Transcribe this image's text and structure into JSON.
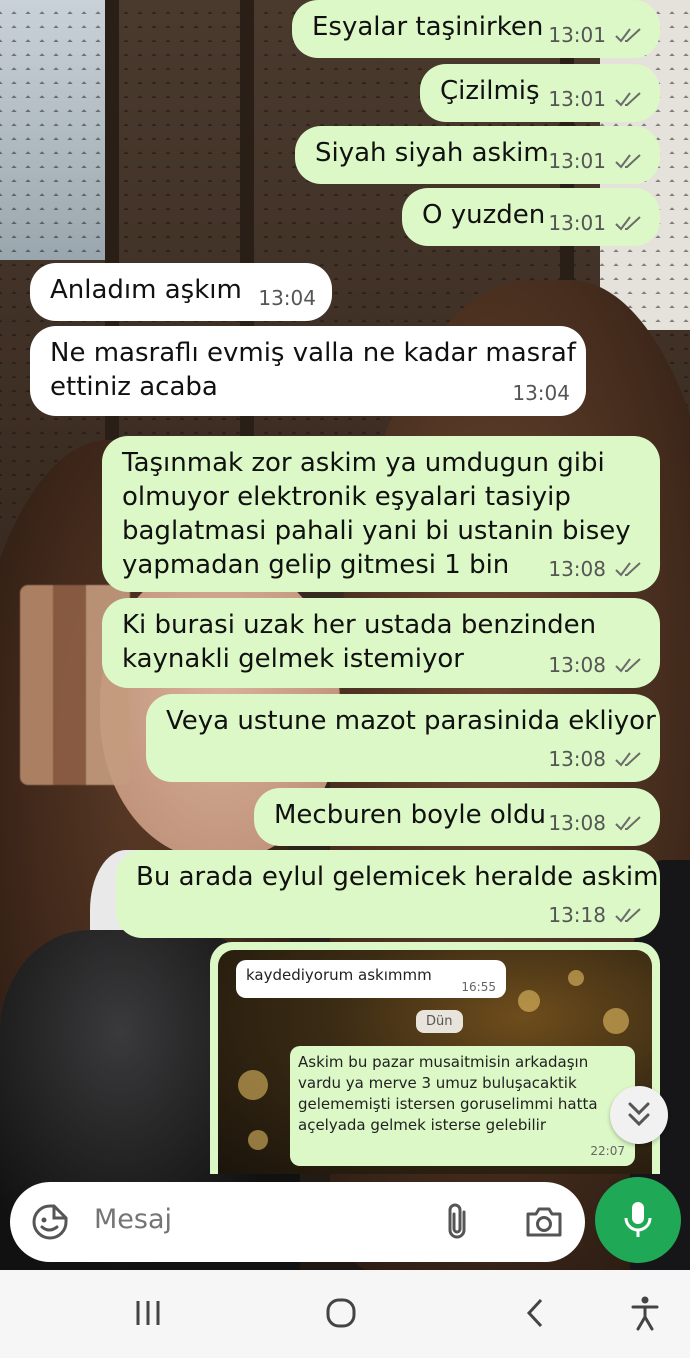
{
  "messages": [
    {
      "dir": "out",
      "text": "Esyalar taşinirken",
      "time": "13:01"
    },
    {
      "dir": "out",
      "text": "Çizilmiş",
      "time": "13:01"
    },
    {
      "dir": "out",
      "text": "Siyah siyah askim",
      "time": "13:01"
    },
    {
      "dir": "out",
      "text": "O yuzden",
      "time": "13:01"
    },
    {
      "dir": "in",
      "text": "Anladım aşkım",
      "time": "13:04"
    },
    {
      "dir": "in",
      "text": "Ne masraflı evmiş valla ne kadar masraf\nettiniz acaba",
      "time": "13:04"
    },
    {
      "dir": "out",
      "text": "Taşınmak zor askim ya umdugun gibi\nolmuyor elektronik eşyalari tasiyip\nbaglatmasi pahali yani bi ustanin bisey\nyapmadan gelip gitmesi 1 bin",
      "time": "13:08"
    },
    {
      "dir": "out",
      "text": "Ki burasi uzak her ustada benzinden\nkaynakli gelmek istemiyor",
      "time": "13:08"
    },
    {
      "dir": "out",
      "text": "Veya ustune mazot parasinida ekliyor",
      "time": "13:08"
    },
    {
      "dir": "out",
      "text": "Mecburen boyle oldu",
      "time": "13:08"
    },
    {
      "dir": "out",
      "text": "Bu arada eylul gelemicek heralde askim",
      "time": "13:18"
    }
  ],
  "image_message": {
    "incoming_text": "kaydediyorum askımmm",
    "incoming_time": "16:55",
    "day_divider": "Dün",
    "outgoing_text": "Askim bu pazar musaitmisin arkadaşın vardu ya merve 3 umuz buluşacaktik gelememişti istersen goruselimmi hatta açelyada gelmek isterse gelebilir",
    "outgoing_time": "22:07"
  },
  "input": {
    "placeholder": "Mesaj"
  },
  "icons": {
    "emoji": "sticker-icon",
    "attach": "paperclip-icon",
    "camera": "camera-icon",
    "mic": "mic-icon",
    "scroll": "double-chevron-down-icon",
    "recent": "recents-icon",
    "home": "home-icon",
    "back": "back-icon",
    "access": "accessibility-icon"
  },
  "colors": {
    "outgoing": "#dcf8c6",
    "incoming": "#ffffff",
    "mic": "#1fa855",
    "ticks": "#6b6b6b"
  }
}
